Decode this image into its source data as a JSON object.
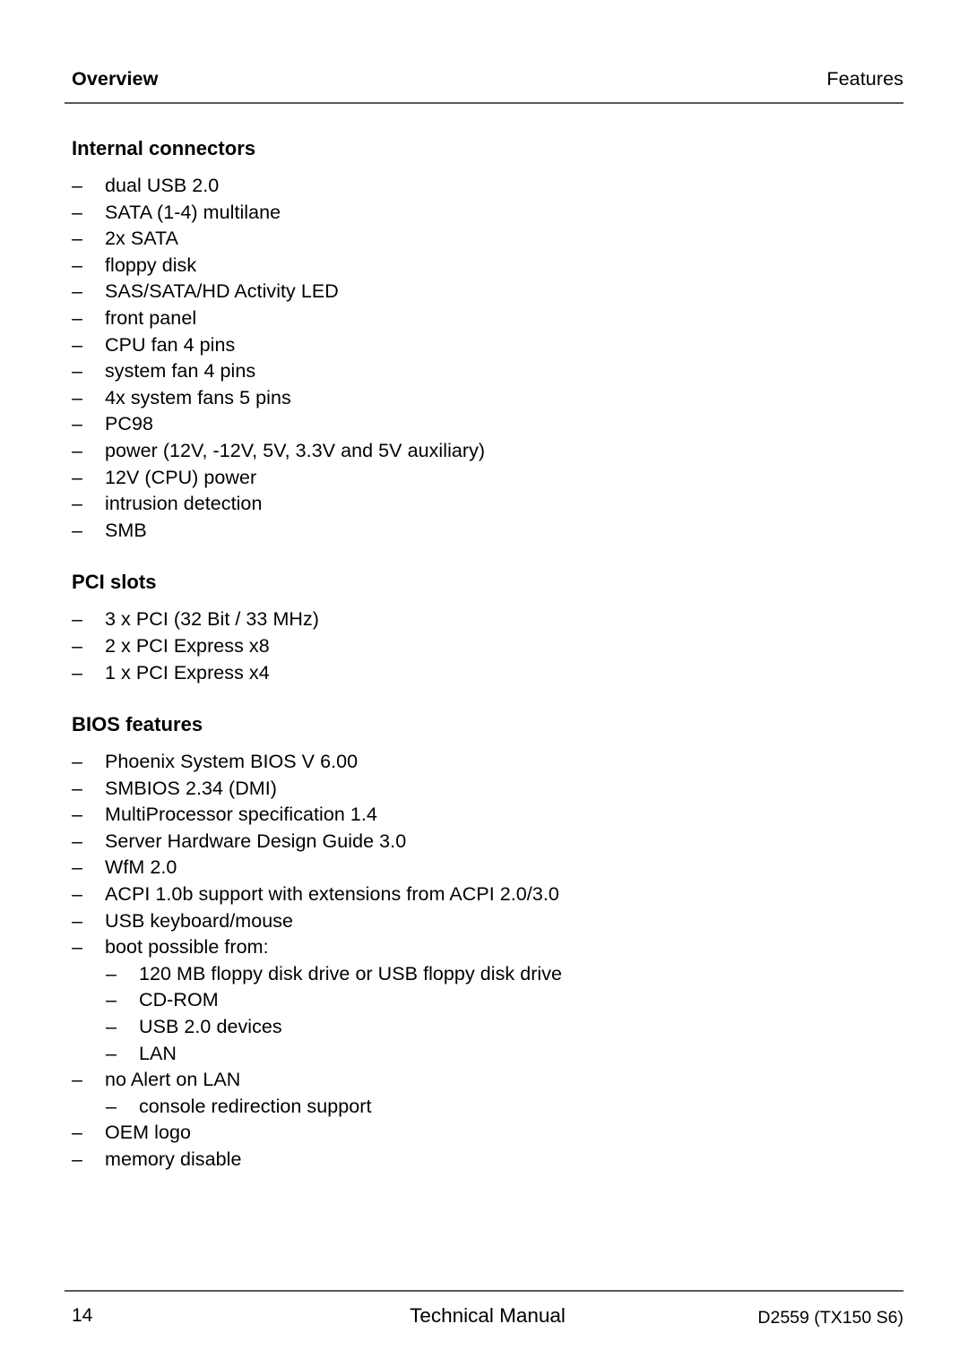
{
  "header": {
    "left": "Overview",
    "right": "Features"
  },
  "sections": [
    {
      "heading": "Internal connectors",
      "items": [
        {
          "text": "dual USB 2.0"
        },
        {
          "text": "SATA (1-4) multilane"
        },
        {
          "text": "2x SATA"
        },
        {
          "text": "floppy disk"
        },
        {
          "text": "SAS/SATA/HD Activity LED"
        },
        {
          "text": "front panel"
        },
        {
          "text": "CPU fan 4 pins"
        },
        {
          "text": "system fan 4 pins"
        },
        {
          "text": "4x system fans 5 pins"
        },
        {
          "text": "PC98"
        },
        {
          "text": "power (12V, -12V, 5V, 3.3V and 5V auxiliary)"
        },
        {
          "text": "12V (CPU) power"
        },
        {
          "text": "intrusion detection"
        },
        {
          "text": "SMB"
        }
      ]
    },
    {
      "heading": "PCI slots",
      "items": [
        {
          "text": "3 x PCI (32 Bit / 33 MHz)"
        },
        {
          "text": "2 x PCI Express x8"
        },
        {
          "text": "1 x PCI Express x4"
        }
      ]
    },
    {
      "heading": "BIOS features",
      "items": [
        {
          "text": "Phoenix System BIOS V 6.00"
        },
        {
          "text": "SMBIOS 2.34 (DMI)"
        },
        {
          "text": "MultiProcessor specification 1.4"
        },
        {
          "text": "Server Hardware Design Guide 3.0"
        },
        {
          "text": "WfM 2.0"
        },
        {
          "text": "ACPI 1.0b support with extensions from ACPI 2.0/3.0"
        },
        {
          "text": "USB keyboard/mouse"
        },
        {
          "text": "boot possible from:",
          "subitems": [
            {
              "text": "120 MB floppy disk drive or USB floppy disk drive"
            },
            {
              "text": "CD-ROM"
            },
            {
              "text": "USB 2.0 devices"
            },
            {
              "text": "LAN"
            }
          ]
        },
        {
          "text": "no Alert on LAN",
          "subitems": [
            {
              "text": "console redirection support"
            }
          ]
        },
        {
          "text": "OEM logo"
        },
        {
          "text": "memory disable"
        }
      ]
    }
  ],
  "bullet_glyph": "–",
  "footer": {
    "page_number": "14",
    "center": "Technical Manual",
    "right": "D2559 (TX150 S6)"
  },
  "colors": {
    "text": "#000000",
    "rule": "#58595b",
    "background": "#ffffff"
  }
}
